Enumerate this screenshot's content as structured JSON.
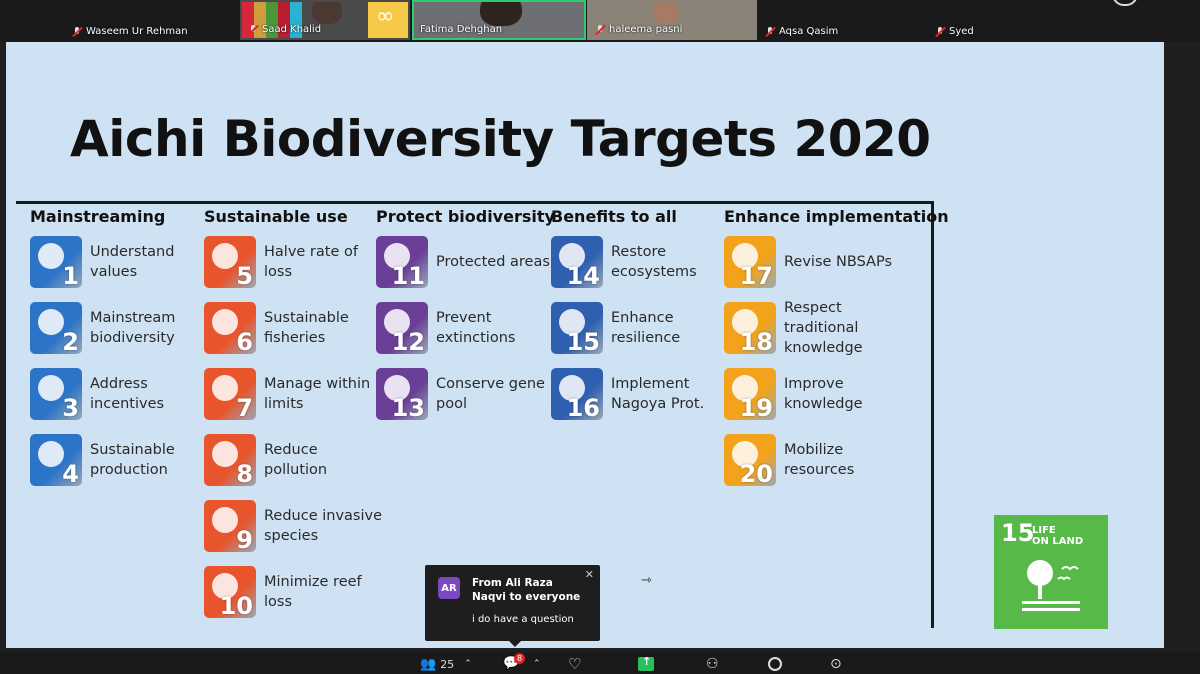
{
  "participants": [
    {
      "name": "Waseem Ur Rehman",
      "muted": true
    },
    {
      "name": "Saad Khalid",
      "muted": true
    },
    {
      "name": "Fatima Dehghan",
      "muted": false,
      "active": true
    },
    {
      "name": "haleema pasni",
      "muted": true
    },
    {
      "name": "Aqsa Qasim",
      "muted": true
    },
    {
      "name": "Syed",
      "muted": true
    }
  ],
  "slide": {
    "title": "Aichi Biodiversity Targets 2020",
    "columns": [
      {
        "heading": "Mainstreaming",
        "color": "#2b74c7",
        "items": [
          {
            "num": "1",
            "label": "Understand values",
            "icon": "head-icon"
          },
          {
            "num": "2",
            "label": "Mainstream biodiversity",
            "icon": "tree-icon"
          },
          {
            "num": "3",
            "label": "Address incentives",
            "icon": "map-icon"
          },
          {
            "num": "4",
            "label": "Sustainable production",
            "icon": "recycle-icon"
          }
        ]
      },
      {
        "heading": "Sustainable use",
        "color": "#e8552c",
        "items": [
          {
            "num": "5",
            "label": "Halve rate of loss",
            "icon": "forest-icon"
          },
          {
            "num": "6",
            "label": "Sustainable fisheries",
            "icon": "fish-icon"
          },
          {
            "num": "7",
            "label": "Manage within limits",
            "icon": "checkbox-icon"
          },
          {
            "num": "8",
            "label": "Reduce pollution",
            "icon": "factory-icon"
          },
          {
            "num": "9",
            "label": "Reduce invasive species",
            "icon": "footprints-icon"
          },
          {
            "num": "10",
            "label": "Minimize reef loss",
            "icon": "coral-icon"
          }
        ]
      },
      {
        "heading": "Protect biodiversity",
        "color": "#6a3f97",
        "items": [
          {
            "num": "11",
            "label": "Protected areas",
            "icon": "fence-icon"
          },
          {
            "num": "12",
            "label": "Prevent extinctions",
            "icon": "rhino-icon"
          },
          {
            "num": "13",
            "label": "Conserve gene pool",
            "icon": "dna-icon"
          }
        ]
      },
      {
        "heading": "Benefits to all",
        "color": "#2e5fb0",
        "items": [
          {
            "num": "14",
            "label": "Restore ecosystems",
            "icon": "rain-icon"
          },
          {
            "num": "15",
            "label": "Enhance resilience",
            "icon": "network-icon"
          },
          {
            "num": "16",
            "label": "Implement Nagoya Prot.",
            "icon": "leaf-hand-icon"
          }
        ]
      },
      {
        "heading": "Enhance implementation",
        "color": "#f2a31b",
        "items": [
          {
            "num": "17",
            "label": "Revise NBSAPs",
            "icon": "chess-icon"
          },
          {
            "num": "18",
            "label": "Respect traditional knowledge",
            "icon": "path-icon"
          },
          {
            "num": "19",
            "label": "Improve knowledge",
            "icon": "binary-icon"
          },
          {
            "num": "20",
            "label": "Mobilize resources",
            "icon": "dollar-icon"
          }
        ]
      }
    ],
    "sdg_badge": {
      "number": "15",
      "text_line1": "LIFE",
      "text_line2": "ON LAND",
      "color": "#56b948"
    }
  },
  "chat_toast": {
    "initials": "AR",
    "from": "From Ali Raza Naqvi to everyone",
    "message": "i do have a question"
  },
  "toolbar": {
    "participants_count": "25",
    "chat_badge": "8"
  }
}
